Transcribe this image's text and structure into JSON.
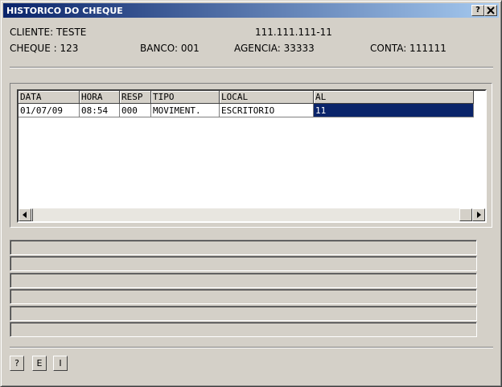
{
  "window": {
    "title": "HISTORICO DO CHEQUE",
    "help_label": "?",
    "close_label": "×"
  },
  "info": {
    "cliente": "CLIENTE: TESTE",
    "documento": "111.111.111-11",
    "cheque": "CHEQUE : 123",
    "banco": "BANCO: 001",
    "agencia": "AGENCIA: 33333",
    "conta": "CONTA: 111111"
  },
  "grid": {
    "columns": [
      "DATA",
      "HORA",
      "RESP",
      "TIPO",
      "LOCAL",
      "AL"
    ],
    "rows": [
      [
        "01/07/09",
        "08:54",
        "000",
        "MOVIMENT.",
        "ESCRITORIO",
        "11"
      ]
    ],
    "selected_cell": "AL"
  },
  "scrollbar": {
    "left_icon": "arrow-left-icon",
    "right_icon": "arrow-right-icon"
  },
  "footer_buttons": [
    "?",
    "E",
    "I"
  ]
}
